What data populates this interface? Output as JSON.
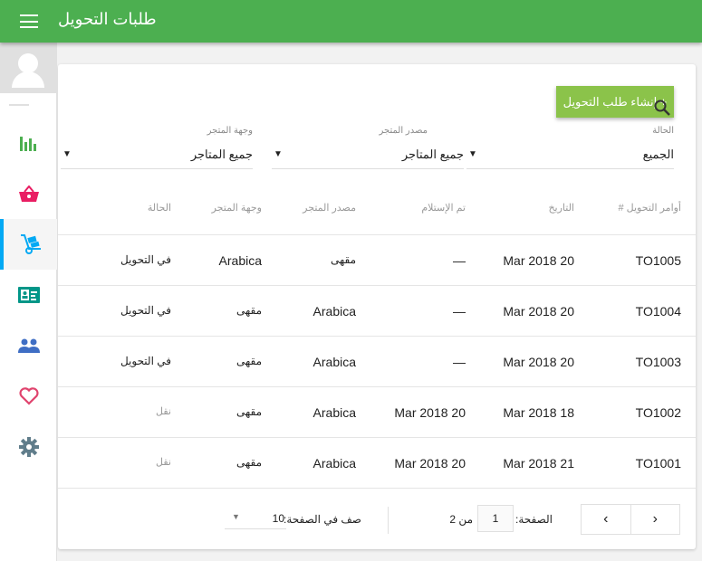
{
  "header": {
    "title": "طلبات التحويل",
    "menu_icon": "hamburger-icon"
  },
  "sidebar": {
    "items": [
      {
        "icon": "bar-chart-icon",
        "color": "#4caf50"
      },
      {
        "icon": "basket-icon",
        "color": "#e91e63"
      },
      {
        "icon": "hand-truck-icon",
        "color": "#03a9f4",
        "active": true
      },
      {
        "icon": "id-card-icon",
        "color": "#009688"
      },
      {
        "icon": "people-icon",
        "color": "#3f6ec4"
      },
      {
        "icon": "heart-icon",
        "color": "#e0446e"
      },
      {
        "icon": "gear-icon",
        "color": "#607d8b"
      }
    ]
  },
  "toolbar": {
    "create_label": "+ إنشاء طلب التحويل"
  },
  "filters": {
    "status": {
      "label": "الحالة",
      "value": "الجميع"
    },
    "source": {
      "label": "مصدر المتجر",
      "value": "جميع المتاجر"
    },
    "destination": {
      "label": "وجهة المتجر",
      "value": "جميع المتاجر"
    }
  },
  "table": {
    "columns": [
      "أوامر التحويل #",
      "التاريخ",
      "تم الإستلام",
      "مصدر المتجر",
      "وجهة المتجر",
      "الحالة"
    ],
    "rows": [
      [
        "TO1005",
        "Mar 2018 20",
        "—",
        "مقهى",
        "Arabica",
        "في التحويل"
      ],
      [
        "TO1004",
        "Mar 2018 20",
        "—",
        "Arabica",
        "مقهى",
        "في التحويل"
      ],
      [
        "TO1003",
        "Mar 2018 20",
        "—",
        "Arabica",
        "مقهى",
        "في التحويل"
      ],
      [
        "TO1002",
        "Mar 2018 18",
        "Mar 2018 20",
        "Arabica",
        "مقهى",
        "نقل"
      ],
      [
        "TO1001",
        "Mar 2018 21",
        "Mar 2018 20",
        "Arabica",
        "مقهى",
        "نقل"
      ]
    ]
  },
  "pagination": {
    "page_label": "الصفحة:",
    "page": "1",
    "of_label": "من 2",
    "rows_label": "صف في الصفحة:",
    "rows_value": "10"
  }
}
